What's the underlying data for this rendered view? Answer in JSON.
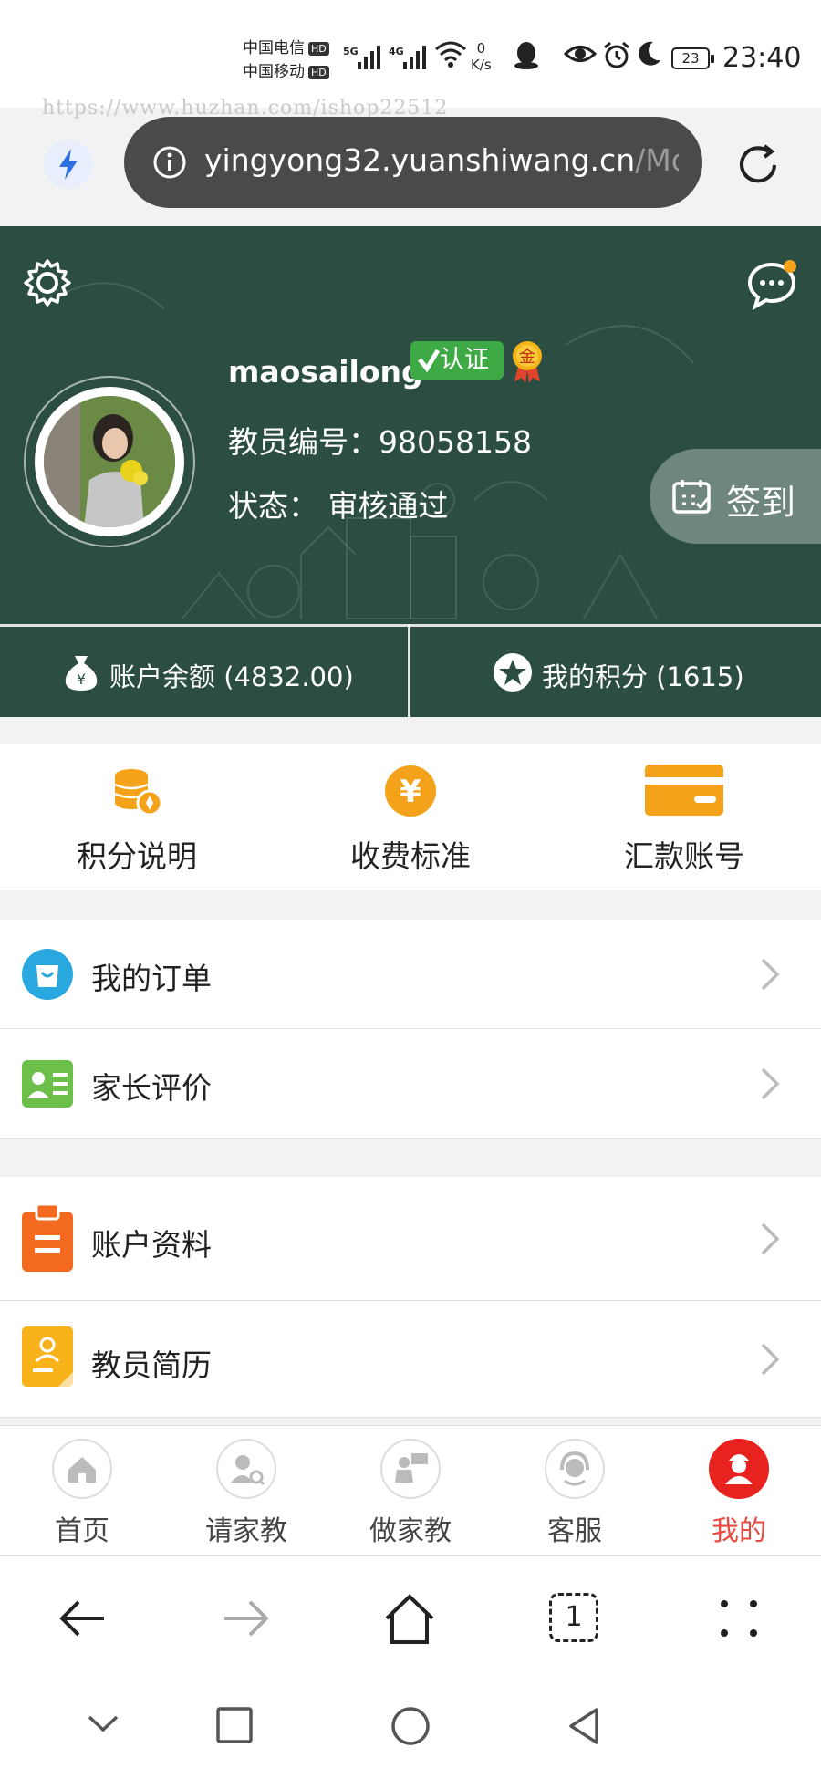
{
  "status_bar": {
    "carrier1": "中国电信",
    "carrier2": "中国移动",
    "hd_badge": "HD",
    "net1": "5G",
    "net2": "4G",
    "speed_value": "0",
    "speed_unit": "K/s",
    "battery": "23",
    "time": "23:40"
  },
  "watermark": "https://www.huzhan.com/ishop22512",
  "address_bar": {
    "url_main": "yingyong32.yuanshiwang.cn",
    "url_dim": "/Mobi"
  },
  "profile": {
    "username": "maosailong",
    "verified_badge": "认证",
    "medal_label": "金",
    "teacher_no": "教员编号：98058158",
    "status": "状态：  审核通过",
    "sign_in": "签到",
    "balance": "账户余额 (4832.00)",
    "balance_icon_glyph": "¥",
    "points": "我的积分 (1615)"
  },
  "quick_links": [
    {
      "label": "积分说明",
      "icon": "coins-icon"
    },
    {
      "label": "收费标准",
      "icon": "yuan-icon"
    },
    {
      "label": "汇款账号",
      "icon": "card-icon"
    }
  ],
  "yuan_glyph": "¥",
  "menu_group1": [
    {
      "label": "我的订单",
      "icon": "bag-icon",
      "color": "#29a8e0"
    },
    {
      "label": "家长评价",
      "icon": "contact-card-icon",
      "color": "#6cc04a"
    }
  ],
  "menu_group2": [
    {
      "label": "账户资料",
      "icon": "clipboard-icon",
      "color": "#f36a1f"
    },
    {
      "label": "教员简历",
      "icon": "resume-icon",
      "color": "#f8b21a"
    }
  ],
  "tabs": [
    {
      "label": "首页",
      "icon": "home-icon"
    },
    {
      "label": "请家教",
      "icon": "find-tutor-icon"
    },
    {
      "label": "做家教",
      "icon": "teach-icon"
    },
    {
      "label": "客服",
      "icon": "headset-icon"
    },
    {
      "label": "我的",
      "icon": "me-icon",
      "active": true
    }
  ],
  "browser": {
    "tab_count": "1"
  },
  "colors": {
    "header_bg": "#2b4d42",
    "accent_orange": "#f5a21b",
    "active_tab": "#e8231f"
  }
}
